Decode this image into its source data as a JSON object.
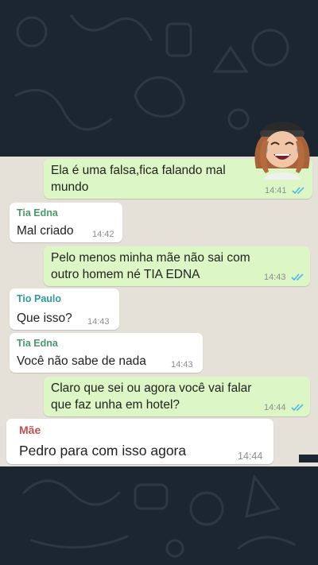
{
  "messages": [
    {
      "direction": "out",
      "text": "Ela é uma falsa,fica falando mal\nmundo",
      "time": "14:41",
      "status": "read"
    },
    {
      "direction": "in",
      "sender": "Tia Edna",
      "text": "Mal criado",
      "time": "14:42"
    },
    {
      "direction": "out",
      "text": "Pelo menos minha mãe não sai com\noutro homem né TIA EDNA",
      "time": "14:43",
      "status": "read"
    },
    {
      "direction": "in",
      "sender": "Tio Paulo",
      "text": "Que isso?",
      "time": "14:43"
    },
    {
      "direction": "in",
      "sender": "Tia Edna",
      "text": "Você não sabe de nada",
      "time": "14:43"
    },
    {
      "direction": "out",
      "text": "Claro que sei ou agora você vai falar\nque faz unha em hotel?",
      "time": "14:44",
      "status": "read"
    },
    {
      "direction": "in",
      "sender": "Mãe",
      "text": "Pedro para com isso agora",
      "time": "14:44"
    }
  ],
  "colors": {
    "outgoing_bubble": "#dcf7c5",
    "incoming_bubble": "#ffffff",
    "chat_background": "#e6e1d8",
    "dark_background": "#1c2630",
    "sender_tia_edna": "#4a9a6a",
    "sender_tio_paulo": "#2f9b9b",
    "sender_mae": "#c0504d",
    "read_check": "#4fb6ec"
  },
  "decoration": {
    "sticker": "laughing-girl-sticker"
  }
}
